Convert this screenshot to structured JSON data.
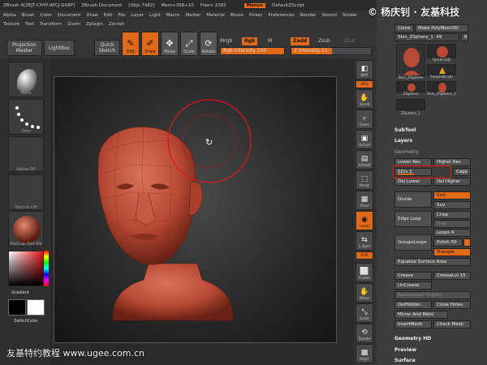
{
  "titlebar": {
    "app": "ZBrush 4[ZEJT-CHYP-AFCJ-DXBF]",
    "doc": "ZBrush Document",
    "objs": "[Objs 7482]",
    "mem": "Mem+398+10",
    "free": "Free+ 2282",
    "menus": "Menus",
    "script": "DefaultZScript"
  },
  "menubar": {
    "row1": [
      "Alpha",
      "Brush",
      "Color",
      "Document",
      "Draw",
      "Edit",
      "File",
      "Layer",
      "Light",
      "Macro",
      "Marker",
      "Material",
      "Movie",
      "Picker",
      "Preferences",
      "Render",
      "Stencil",
      "Stroke"
    ],
    "row2": [
      "Texture",
      "Tool",
      "Transform",
      "Zoom",
      "Zplugin",
      "Zscript"
    ]
  },
  "toolbar": {
    "projection_master": "Projection Master",
    "lightbox": "LightBox",
    "quick_sketch": "Quick Sketch",
    "edit": "Edit",
    "draw": "Draw",
    "move": "Move",
    "scale": "Scale",
    "rotate": "Rotate",
    "mrgb": "Mrgb",
    "rgb": "Rgb",
    "m": "M",
    "zadd": "Zadd",
    "zsub": "Zsub",
    "zcut": "Zcut",
    "rgb_intensity": "Rgb Intensity 100",
    "z_intensity": "Z Intensity 51",
    "rgb_intensity_level": 1.0,
    "z_intensity_level": 0.51
  },
  "leftshelf": {
    "items": [
      "Move",
      "Dots",
      "Alpha Off",
      "Texture Off",
      "MatCap Red Wa"
    ],
    "gradient": "Gradient",
    "switch_color": "SwitchColor"
  },
  "rightcol": {
    "buttons": [
      "BPR",
      "SPix",
      "Scroll",
      "Zoom",
      "Actual",
      "AAHalf",
      "Persp",
      "Floor",
      "Local",
      "L.Sym",
      "XYZ",
      "Frame",
      "Move",
      "Scale",
      "Rotate",
      "PolyF"
    ]
  },
  "palette": {
    "clone": "Clone",
    "make_polymesh": "Make PolyMesh3D",
    "current_tool": "Skin_ZSphere_1. 49",
    "r": "R",
    "thumbs": [
      "Skin_ZSphere",
      "Sphere3D",
      "SimpleBrush",
      "ZSphere",
      "Skin_ZSphere_1",
      "ZSphere_1"
    ],
    "subtool": "SubTool",
    "layers": "Layers",
    "geometry": "Geometry",
    "lower_res": "Lower Res",
    "higher_res": "Higher Res",
    "sdiv": "SDiv 2",
    "cage": "Cage",
    "del_lower": "Del Lower",
    "del_higher": "Del Higher",
    "divide": "Divide",
    "smt": "Smt",
    "suv": "Suv",
    "edge_loop": "Edge Loop",
    "crisp": "Crisp",
    "disp": "Disp",
    "loops": "Loops 4",
    "grouploops": "GroupsLoops",
    "polish": "Polish 50",
    "triangle": "Triangle",
    "equalize": "Equalize Surface Area",
    "crease": "Crease",
    "creaselvl": "CreaseLvl 15",
    "uncrease": "UnCrease",
    "reconstruct": "Reconstruct Subdiv",
    "delhidden": "DelHidden",
    "close_holes": "Close Holes",
    "mirror_weld": "Mirror And Weld",
    "insertmesh": "InsertMesh",
    "check_mesh": "Check Mesh",
    "geometry_hd": "Geometry HD",
    "preview": "Preview",
    "surface": "Surface"
  },
  "watermarks": {
    "top_right": "© 杨庆钊 · 友基科技",
    "bottom_left": "友基特约教程 www.ugee.com.cn"
  },
  "colors": {
    "accent": "#e0691a",
    "model": "#b84a35",
    "highlight": "#e8141a"
  }
}
